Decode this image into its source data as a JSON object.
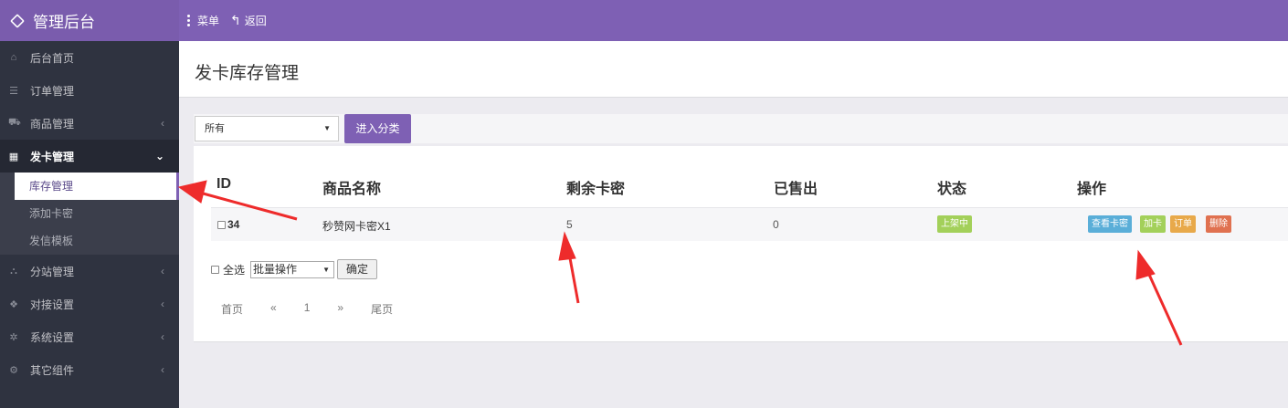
{
  "app": {
    "title": "管理后台"
  },
  "topnav": {
    "menu_label": "菜单",
    "back_label": "返回"
  },
  "sidebar": {
    "items": [
      {
        "label": "后台首页",
        "icon": "home-icon",
        "expandable": false
      },
      {
        "label": "订单管理",
        "icon": "list-icon",
        "expandable": false
      },
      {
        "label": "商品管理",
        "icon": "cart-icon",
        "expandable": true
      },
      {
        "label": "发卡管理",
        "icon": "grid-icon",
        "expandable": true,
        "active": true
      },
      {
        "label": "分站管理",
        "icon": "sitemap-icon",
        "expandable": true
      },
      {
        "label": "对接设置",
        "icon": "cubes-icon",
        "expandable": true
      },
      {
        "label": "系统设置",
        "icon": "gear-icon",
        "expandable": true
      },
      {
        "label": "其它组件",
        "icon": "gears-icon",
        "expandable": true
      }
    ],
    "submenu": [
      "库存管理",
      "添加卡密",
      "发信模板"
    ]
  },
  "page": {
    "title": "发卡库存管理"
  },
  "filter": {
    "selected": "所有",
    "submit_label": "进入分类"
  },
  "table": {
    "headers": [
      "ID",
      "商品名称",
      "剩余卡密",
      "已售出",
      "状态",
      "操作"
    ],
    "rows": [
      {
        "id": "34",
        "name": "秒赞网卡密X1",
        "remaining": "5",
        "sold": "0",
        "status": "上架中",
        "actions": [
          "查看卡密",
          "加卡",
          "订单",
          "删除"
        ]
      }
    ]
  },
  "bulk": {
    "select_all_label": "全选",
    "action_selected": "批量操作",
    "confirm_label": "确定"
  },
  "pagination": {
    "first": "首页",
    "prev": "«",
    "current": "1",
    "next": "»",
    "last": "尾页"
  },
  "colors": {
    "accent": "#7e60b4",
    "sidebar": "#2f3340",
    "annotation_arrow": "#ee2b2b"
  }
}
